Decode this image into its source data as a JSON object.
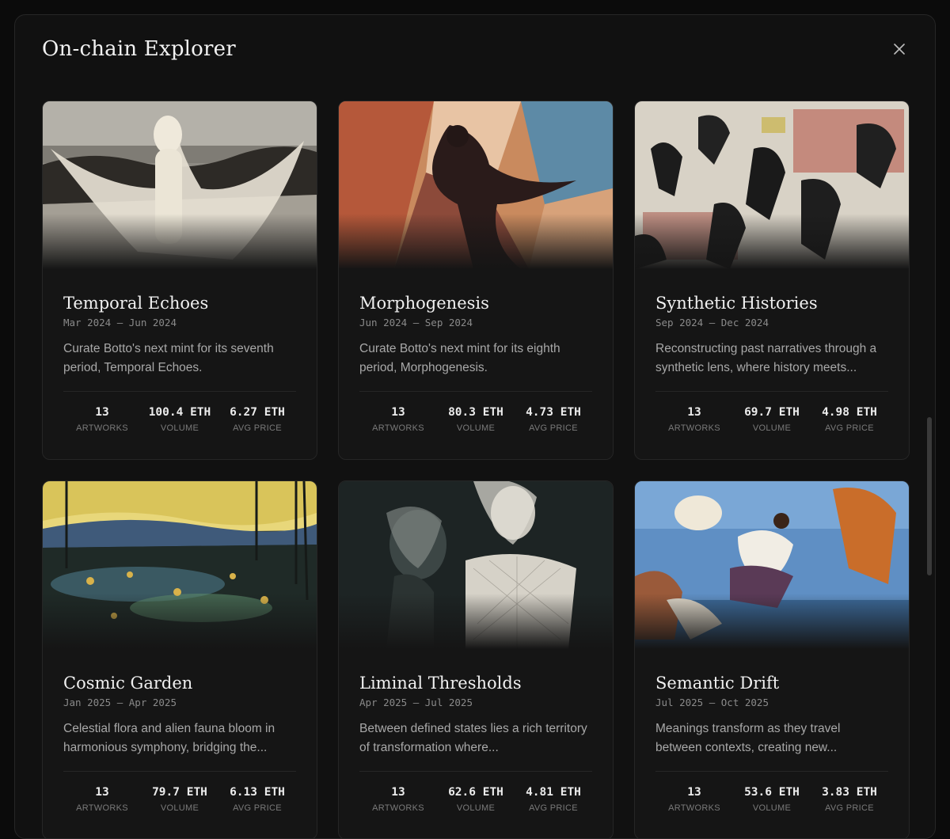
{
  "modal": {
    "title": "On-chain Explorer",
    "close_icon": "close-icon"
  },
  "stat_labels": {
    "artworks": "ARTWORKS",
    "volume": "VOLUME",
    "avg_price": "AVG PRICE"
  },
  "cards": [
    {
      "title": "Temporal Echoes",
      "dates": "Mar 2024 — Jun 2024",
      "description": "Curate Botto's next mint for its seventh period, Temporal Echoes.",
      "artworks": "13",
      "volume": "100.4 ETH",
      "avg_price": "6.27 ETH",
      "image": "veiled-figure-on-beach-image"
    },
    {
      "title": "Morphogenesis",
      "dates": "Jun 2024 — Sep 2024",
      "description": "Curate Botto's next mint for its eighth period, Morphogenesis.",
      "artworks": "13",
      "volume": "80.3 ETH",
      "avg_price": "4.73 ETH",
      "image": "abstract-dancing-figure-image"
    },
    {
      "title": "Synthetic Histories",
      "dates": "Sep 2024 — Dec 2024",
      "description": "Reconstructing past narratives through a synthetic lens, where history meets...",
      "artworks": "13",
      "volume": "69.7 ETH",
      "avg_price": "4.98 ETH",
      "image": "collage-leaping-figures-image"
    },
    {
      "title": "Cosmic Garden",
      "dates": "Jan 2025 — Apr 2025",
      "description": "Celestial flora and alien fauna bloom in harmonious symphony, bridging the...",
      "artworks": "13",
      "volume": "79.7 ETH",
      "avg_price": "6.13 ETH",
      "image": "glowing-garden-landscape-image"
    },
    {
      "title": "Liminal Thresholds",
      "dates": "Apr 2025 — Jul 2025",
      "description": "Between defined states lies a rich territory of transformation where...",
      "artworks": "13",
      "volume": "62.6 ETH",
      "avg_price": "4.81 ETH",
      "image": "mesh-veiled-figures-image"
    },
    {
      "title": "Semantic Drift",
      "dates": "Jul 2025 — Oct 2025",
      "description": "Meanings transform as they travel between contexts, creating new...",
      "artworks": "13",
      "volume": "53.6 ETH",
      "avg_price": "3.83 ETH",
      "image": "floating-figures-sky-image"
    }
  ]
}
